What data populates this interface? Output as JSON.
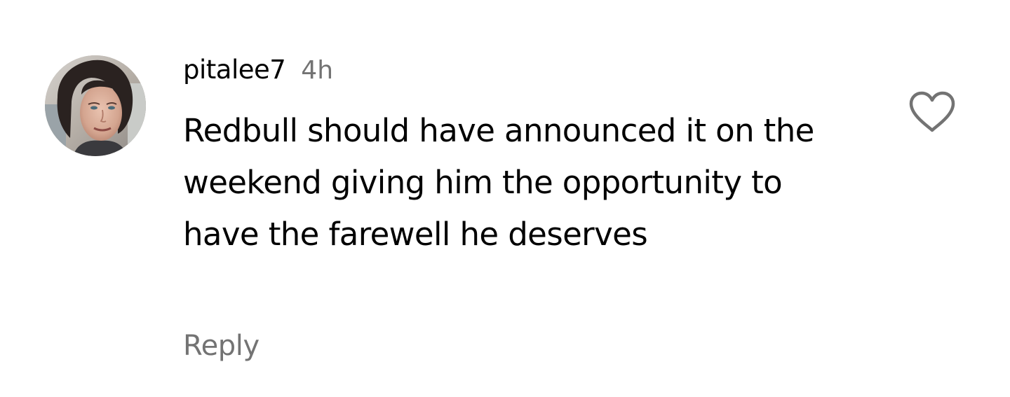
{
  "comment": {
    "username": "pitalee7",
    "timestamp": "4h",
    "text": "Redbull should have announced it on the weekend giving him the opportunity to have the farewell he deserves",
    "reply_label": "Reply"
  },
  "icons": {
    "like": "heart-outline-icon",
    "avatar": "user-avatar"
  },
  "colors": {
    "text_primary": "#000000",
    "text_secondary": "#737373",
    "icon_stroke": "#737373",
    "background": "#ffffff"
  }
}
